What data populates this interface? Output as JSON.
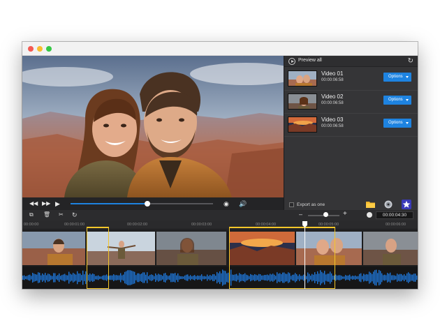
{
  "window": {
    "title": ""
  },
  "panel": {
    "preview_all": "Preview all",
    "items": [
      {
        "name": "Video 01",
        "time": "00:00:06:58",
        "button": "Options"
      },
      {
        "name": "Video 02",
        "time": "00:00:06:58",
        "button": "Options"
      },
      {
        "name": "Video 03",
        "time": "00:00:06:58",
        "button": "Options"
      }
    ],
    "export_label": "Export as one",
    "export_checked": false
  },
  "player": {
    "progress": 0.54
  },
  "toolbar": {
    "zoom_level": 0.57,
    "time": "00:00:04:30"
  },
  "timeline": {
    "ruler_labels": [
      "00:00:00",
      "00:00:01:00",
      "00:00:02:00",
      "00:00:03:00",
      "00:00:04:00",
      "00:00:05:00",
      "00:00:06:00"
    ]
  },
  "icons": {
    "preview_all": "play-circle-icon",
    "refresh": "refresh-icon",
    "rewind": "rewind-icon",
    "fast_forward": "fast-forward-icon",
    "play": "play-icon",
    "snapshot": "snapshot-icon",
    "volume": "volume-icon",
    "import": "import-icon",
    "delete": "trash-icon",
    "cut": "scissors-icon",
    "rotate": "rotate-icon",
    "folder": "folder-icon",
    "burn": "disc-icon",
    "effects": "star-icon",
    "clock": "clock-icon"
  },
  "colors": {
    "accent": "#1e83e0",
    "selection": "#f3c62a",
    "waveform": "#1f77d9"
  }
}
